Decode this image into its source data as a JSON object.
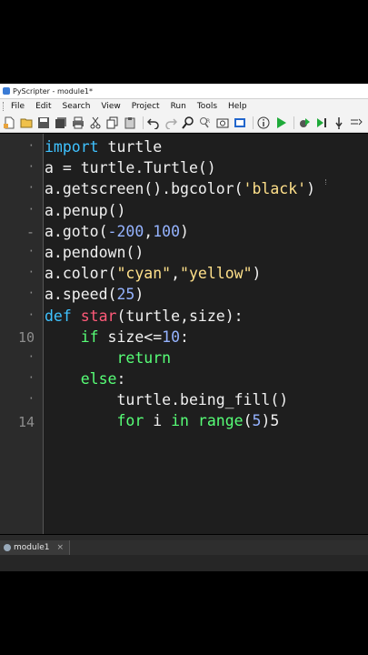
{
  "window": {
    "title": "PyScripter - module1*"
  },
  "menu": [
    "File",
    "Edit",
    "Search",
    "View",
    "Project",
    "Run",
    "Tools",
    "Help"
  ],
  "toolbar_icons": [
    "new-file-icon",
    "open-folder-icon",
    "save-icon",
    "save-all-icon",
    "print-icon",
    "cut-icon",
    "copy-icon",
    "paste-icon",
    "undo-icon",
    "redo-icon",
    "search-icon",
    "replace-icon",
    "image-icon",
    "debugger-icon",
    "info-icon",
    "run-icon",
    "debug-run-icon",
    "step-icon",
    "step-into-icon",
    "more-icon"
  ],
  "editor": {
    "line_numbers": [
      {
        "text": "·",
        "line": 0
      },
      {
        "text": "·",
        "line": 1
      },
      {
        "text": "·",
        "line": 2
      },
      {
        "text": "·",
        "line": 3
      },
      {
        "text": "-",
        "line": 4
      },
      {
        "text": "·",
        "line": 5
      },
      {
        "text": "·",
        "line": 6
      },
      {
        "text": "·",
        "line": 7
      },
      {
        "text": "·",
        "line": 8
      },
      {
        "text": "10",
        "line": 9
      },
      {
        "text": "·",
        "line": 10
      },
      {
        "text": "·",
        "line": 11
      },
      {
        "text": "·",
        "line": 12
      },
      {
        "text": "14",
        "line": 13
      }
    ],
    "lines": [
      [
        {
          "t": "import",
          "c": "kw"
        },
        {
          "t": " turtle"
        }
      ],
      [
        {
          "t": "a = turtle.Turtle()"
        }
      ],
      [
        {
          "t": "a.getscreen().bgcolor("
        },
        {
          "t": "'black'",
          "c": "str"
        },
        {
          "t": ")"
        }
      ],
      [
        {
          "t": "a.penup()"
        }
      ],
      [
        {
          "t": "a.goto("
        },
        {
          "t": "-200",
          "c": "num"
        },
        {
          "t": ","
        },
        {
          "t": "100",
          "c": "num"
        },
        {
          "t": ")"
        }
      ],
      [
        {
          "t": "a.pendown()"
        }
      ],
      [
        {
          "t": "a.color("
        },
        {
          "t": "\"cyan\"",
          "c": "str"
        },
        {
          "t": ","
        },
        {
          "t": "\"yellow\"",
          "c": "str"
        },
        {
          "t": ")"
        }
      ],
      [
        {
          "t": "a.speed("
        },
        {
          "t": "25",
          "c": "num"
        },
        {
          "t": ")"
        }
      ],
      [
        {
          "t": "def",
          "c": "kw"
        },
        {
          "t": " "
        },
        {
          "t": "star",
          "c": "fn"
        },
        {
          "t": "(turtle,size):"
        }
      ],
      [
        {
          "t": "    "
        },
        {
          "t": "if",
          "c": "kw2"
        },
        {
          "t": " size<="
        },
        {
          "t": "10",
          "c": "num"
        },
        {
          "t": ":"
        }
      ],
      [
        {
          "t": "        "
        },
        {
          "t": "return",
          "c": "kw2"
        }
      ],
      [
        {
          "t": "    "
        },
        {
          "t": "else",
          "c": "kw2"
        },
        {
          "t": ":"
        }
      ],
      [
        {
          "t": "        turtle.being_fill()"
        }
      ],
      [
        {
          "t": "        "
        },
        {
          "t": "for",
          "c": "kw2"
        },
        {
          "t": " i "
        },
        {
          "t": "in",
          "c": "kw2"
        },
        {
          "t": " "
        },
        {
          "t": "range",
          "c": "kw2"
        },
        {
          "t": "("
        },
        {
          "t": "5",
          "c": "num"
        },
        {
          "t": ")5"
        }
      ]
    ]
  },
  "tabs": [
    {
      "label": "module1",
      "close": "×"
    }
  ],
  "colors": {
    "editor_bg": "#1e1e1e",
    "keyword": "#3fc2ff",
    "keyword2": "#57ff77",
    "string": "#ffe08a",
    "number": "#95b3ff",
    "function": "#ff5a79"
  }
}
